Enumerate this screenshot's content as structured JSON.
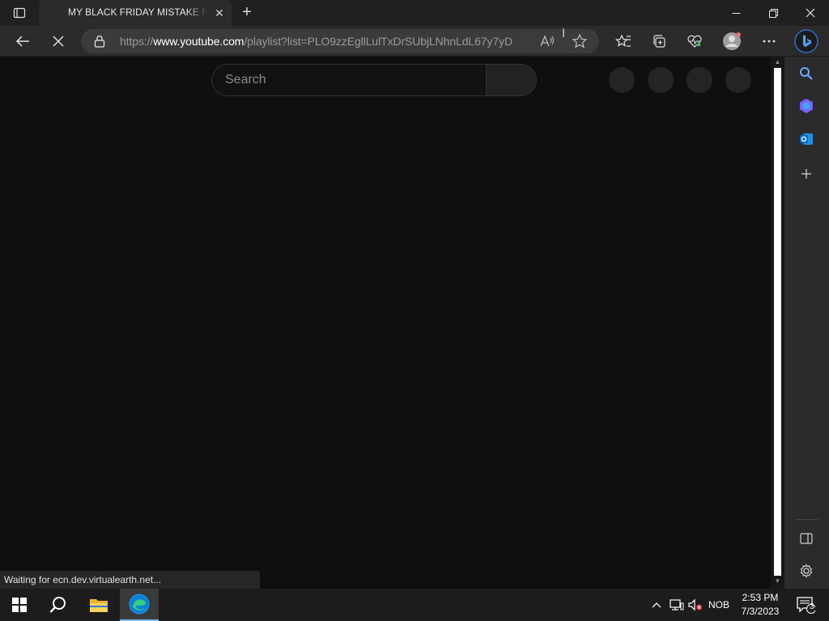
{
  "browser": {
    "tab_title": "MY BLACK FRIDAY MISTAKE Rend",
    "url_scheme": "https://",
    "url_host": "www.youtube.com",
    "url_path": "/playlist?list=PLO9zzEgllLulTxDrSUbjLNhnLdL67y7yD",
    "read_aloud_label": "A'",
    "status_text": "Waiting for ecn.dev.virtualearth.net..."
  },
  "page": {
    "search_placeholder": "Search"
  },
  "taskbar": {
    "language": "NOB",
    "time": "2:53 PM",
    "date": "7/3/2023",
    "notification_count": "3"
  },
  "colors": {
    "page_bg": "#0f0f0f",
    "chrome_bg": "#2b2b2b",
    "taskbar_bg": "#1c1c1c",
    "edge_accent": "#76b9ed"
  }
}
